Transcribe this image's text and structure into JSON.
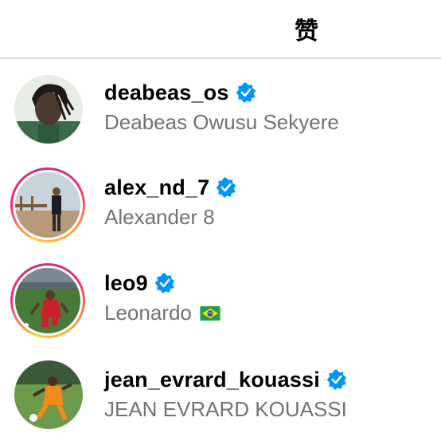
{
  "header": {
    "title": "赞"
  },
  "users": [
    {
      "username": "deabeas_os",
      "full_name": "Deabeas Owusu Sekyere",
      "verified": true,
      "story_ring": false
    },
    {
      "username": "alex_nd_7",
      "full_name": "Alexander 8",
      "verified": true,
      "story_ring": true
    },
    {
      "username": "leo9",
      "full_name": "Leonardo",
      "verified": true,
      "story_ring": true,
      "flag": "brazil-flag-icon"
    },
    {
      "username": "jean_evrard_kouassi",
      "full_name": "JEAN EVRARD KOUASSI",
      "verified": true,
      "story_ring": false
    }
  ],
  "colors": {
    "verified_badge": "#0095f6",
    "secondary_text": "#737373",
    "divider": "#dbdbdb"
  }
}
